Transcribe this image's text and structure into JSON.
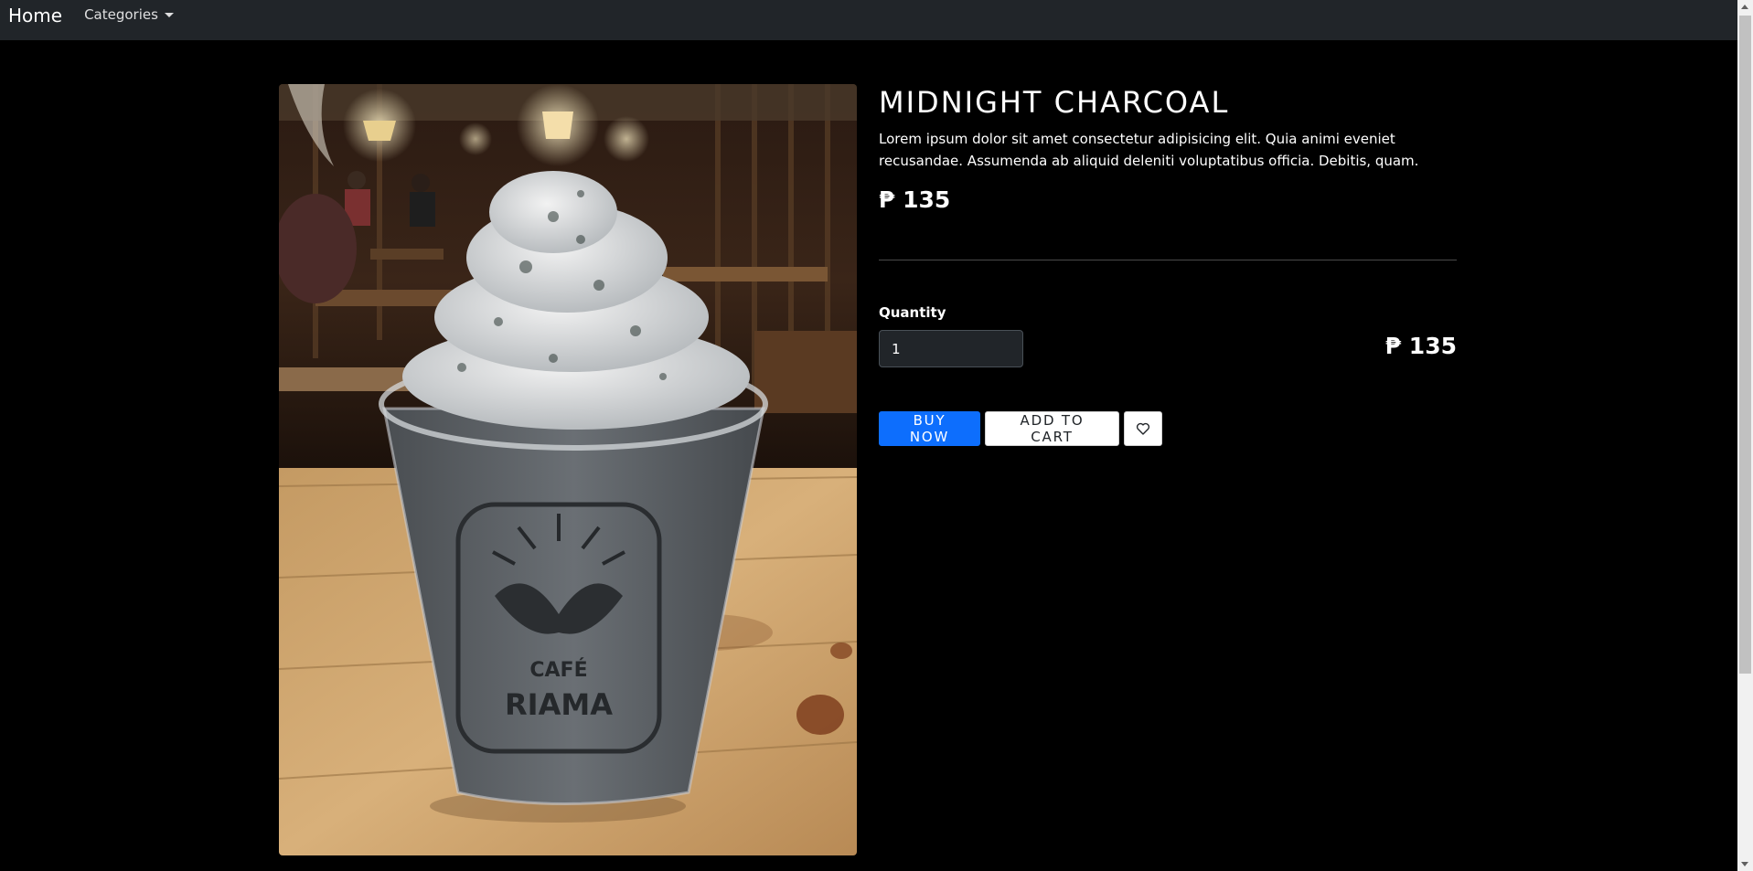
{
  "navbar": {
    "brand": "Home",
    "categories_label": "Categories"
  },
  "product": {
    "name": "MIDNIGHT CHARCOAL",
    "description": "Lorem ipsum dolor sit amet consectetur adipisicing elit. Quia animi eveniet recusandae. Assumenda ab aliquid deleniti voluptatibus officia. Debitis, quam.",
    "price": "₱ 135",
    "image_cup_logo_line1": "CAFÉ",
    "image_cup_logo_line2": "RIAMA"
  },
  "order": {
    "quantity_label": "Quantity",
    "quantity_value": "1",
    "total_price": "₱ 135"
  },
  "actions": {
    "buy_now": "BUY NOW",
    "add_to_cart": "ADD TO CART",
    "wishlist_icon": "heart-icon"
  },
  "colors": {
    "page_bg": "#000000",
    "navbar_bg": "#212529",
    "primary": "#0d6efd"
  }
}
